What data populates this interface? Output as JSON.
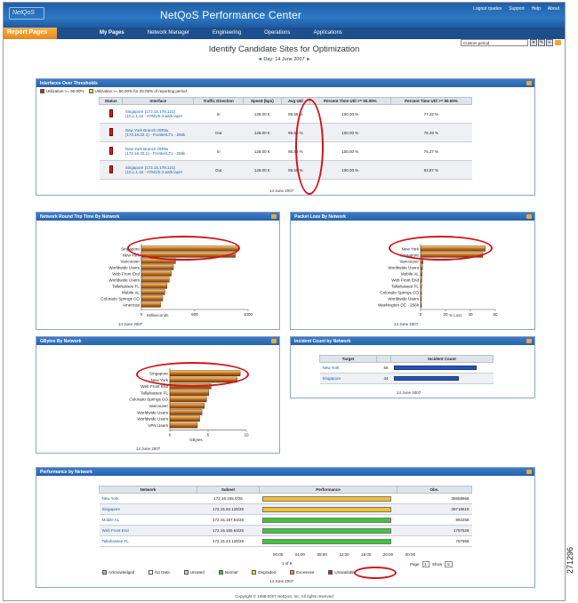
{
  "figure_id": "271296",
  "header": {
    "logo": "NetQoS",
    "app_title": "NetQoS Performance Center",
    "top_links": [
      "Logout rpadev",
      "Support",
      "Help",
      "About"
    ]
  },
  "nav": {
    "first": "Report Pages",
    "items": [
      "My Pages",
      "Network Manager",
      "Engineering",
      "Operations",
      "Applications"
    ],
    "selected": "My Pages"
  },
  "search": {
    "value": "Custom period",
    "buttons": [
      "▾",
      "✎",
      "+"
    ]
  },
  "page": {
    "title": "Identify Candidate Sites for Optimization",
    "date_label": "Day: 14 June 2007",
    "prev": "◄",
    "next": "►"
  },
  "interfaces": {
    "title": "Interfaces Over Thresholds",
    "legend": [
      {
        "label": "Utilization >= 90.00%",
        "color": "#c22222"
      },
      {
        "label": "Utilization >= 50.00% for 25.00% of reporting period",
        "color": "#f2e01c"
      }
    ],
    "columns": [
      "Status",
      "Interface",
      "Traffic Direction",
      "Speed (bps)",
      "Avg Util",
      "Percent Time Util >= 50.00%",
      "Percent Time Util >= 90.00%"
    ],
    "rows": [
      {
        "interface": "Singapore (172.15.179.121) (10.1.1.15 - ATM1/0.3-aal5 layer",
        "direction": "In",
        "speed": "128.00 K",
        "avg": "95.65 %",
        "p50": "100.00 %",
        "p90": "77.42 %"
      },
      {
        "interface": "New York Branch OtRtw (172.16.32.1) - FrontierLT1 - 256k",
        "direction": "Out",
        "speed": "128.00 K",
        "avg": "95.60 %",
        "p50": "100.00 %",
        "p90": "76.49 %"
      },
      {
        "interface": "New York Branch OtRtw (172.16.32.1) - FrontierLT1 - 256k",
        "direction": "In",
        "speed": "128.00 K",
        "avg": "95.59 %",
        "p50": "100.00 %",
        "p90": "75.27 %"
      },
      {
        "interface": "Singapore (172.15.179.121) (10.1.1.15 - ATM1/0.3-aal5 layer",
        "direction": "Out",
        "speed": "128.00 K",
        "avg": "95.55 %",
        "p50": "100.00 %",
        "p90": "83.87 %"
      }
    ],
    "date": "14 June 2007"
  },
  "rtt": {
    "title": "Network Round Trip Time By Network",
    "xlabel": "Milliseconds",
    "date": "14 June 2007"
  },
  "loss": {
    "title": "Packet Loss By Network",
    "xlabel": "% Lost",
    "date": "14 June 2007"
  },
  "gbytes": {
    "title": "GBytes By Network",
    "xlabel": "GBytes",
    "date": "14 June 2007"
  },
  "incident": {
    "title": "Incident Count by Network",
    "columns": [
      "Target",
      "Incident Count"
    ],
    "rows": [
      {
        "target": "New York",
        "count": "56",
        "value": 56
      },
      {
        "target": "Singapore",
        "count": "44",
        "value": 44
      }
    ],
    "date": "14 June 2007"
  },
  "performance": {
    "title": "Performance by Network",
    "columns": [
      "Network",
      "Subnet",
      "Performance",
      "Obs."
    ],
    "rows": [
      {
        "network": "New York",
        "subnet": "172.16.155.0/28",
        "obs": "38658968",
        "status": "Degraded",
        "color": "#f2c12e"
      },
      {
        "network": "Singapore",
        "subnet": "172.15.92.128/28",
        "obs": "38718618",
        "status": "Degraded",
        "color": "#f2c12e"
      },
      {
        "network": "Mobile AL",
        "subnet": "172.15.187.64/26",
        "obs": "892258",
        "status": "Normal",
        "color": "#3cc63c"
      },
      {
        "network": "Web Front End",
        "subnet": "172.16.155.64/26",
        "obs": "1797628",
        "status": "Normal",
        "color": "#3cc63c"
      },
      {
        "network": "Tallahassee FL",
        "subnet": "172.15.43.128/26",
        "obs": "797658",
        "status": "Normal",
        "color": "#3cc63c"
      }
    ],
    "time_ticks": [
      "00:00",
      "04:00",
      "08:00",
      "12:00",
      "16:00",
      "20:00",
      "00:00"
    ],
    "pager": {
      "page_label": "Page",
      "page_value": "1",
      "show_label": "Show",
      "show_value": "5",
      "range": "1 of 6"
    },
    "legend": [
      {
        "label": "Acknowledged",
        "color": "#b8b8b8"
      },
      {
        "label": "No Data",
        "color": "#ffffff"
      },
      {
        "label": "Unrated",
        "color": "#d0d0d0"
      },
      {
        "label": "Normal",
        "color": "#3cc63c"
      },
      {
        "label": "Degraded",
        "color": "#f2e01c"
      },
      {
        "label": "Excessive",
        "color": "#f29a1c"
      },
      {
        "label": "Unavailable",
        "color": "#c22222"
      }
    ],
    "date": "14 June 2007"
  },
  "footer": "Copyright © 1999-2007 NetQoS, Inc. All rights reserved",
  "chart_data": [
    {
      "type": "bar",
      "orientation": "horizontal",
      "title": "Network Round Trip Time By Network",
      "xlabel": "Milliseconds",
      "xlim": [
        0,
        1000
      ],
      "xticks": [
        "0",
        "500",
        "1000"
      ],
      "categories": [
        "Singapore",
        "New York",
        "Vancouver",
        "Worldwide Users",
        "Web Front End",
        "Worldwide Users",
        "Tallahassee FL",
        "Mobile AL",
        "Colorado Springs CO",
        "Americas"
      ],
      "values": [
        910,
        880,
        320,
        300,
        280,
        260,
        240,
        220,
        200,
        180
      ]
    },
    {
      "type": "bar",
      "orientation": "horizontal",
      "title": "Packet Loss By Network",
      "xlabel": "% Lost",
      "xlim": [
        0,
        60
      ],
      "xticks": [
        "0",
        "20",
        "40",
        "60"
      ],
      "categories": [
        "New York",
        "Singapore",
        "Vancouver",
        "Worldwide Users",
        "Mobile AL",
        "Web Front End",
        "Tallahassee FL",
        "Colorado Springs CO",
        "Worldwide Users",
        "Washington DC - 256k"
      ],
      "values": [
        52,
        50,
        2,
        1.5,
        1.2,
        1,
        0.8,
        0.6,
        0.5,
        0.4
      ]
    },
    {
      "type": "bar",
      "orientation": "horizontal",
      "title": "GBytes By Network",
      "xlabel": "GBytes",
      "xlim": [
        0,
        10
      ],
      "xticks": [
        "0",
        "5",
        "10"
      ],
      "categories": [
        "Singapore",
        "New York",
        "Web Front End",
        "Tallahassee FL",
        "Colorado Springs CO",
        "Vancouver",
        "Worldwide Users",
        "Worldwide Users",
        "VPN Users"
      ],
      "values": [
        9.2,
        8.8,
        5.4,
        5.1,
        4.8,
        4.5,
        4.2,
        3.9,
        3.6
      ]
    }
  ]
}
